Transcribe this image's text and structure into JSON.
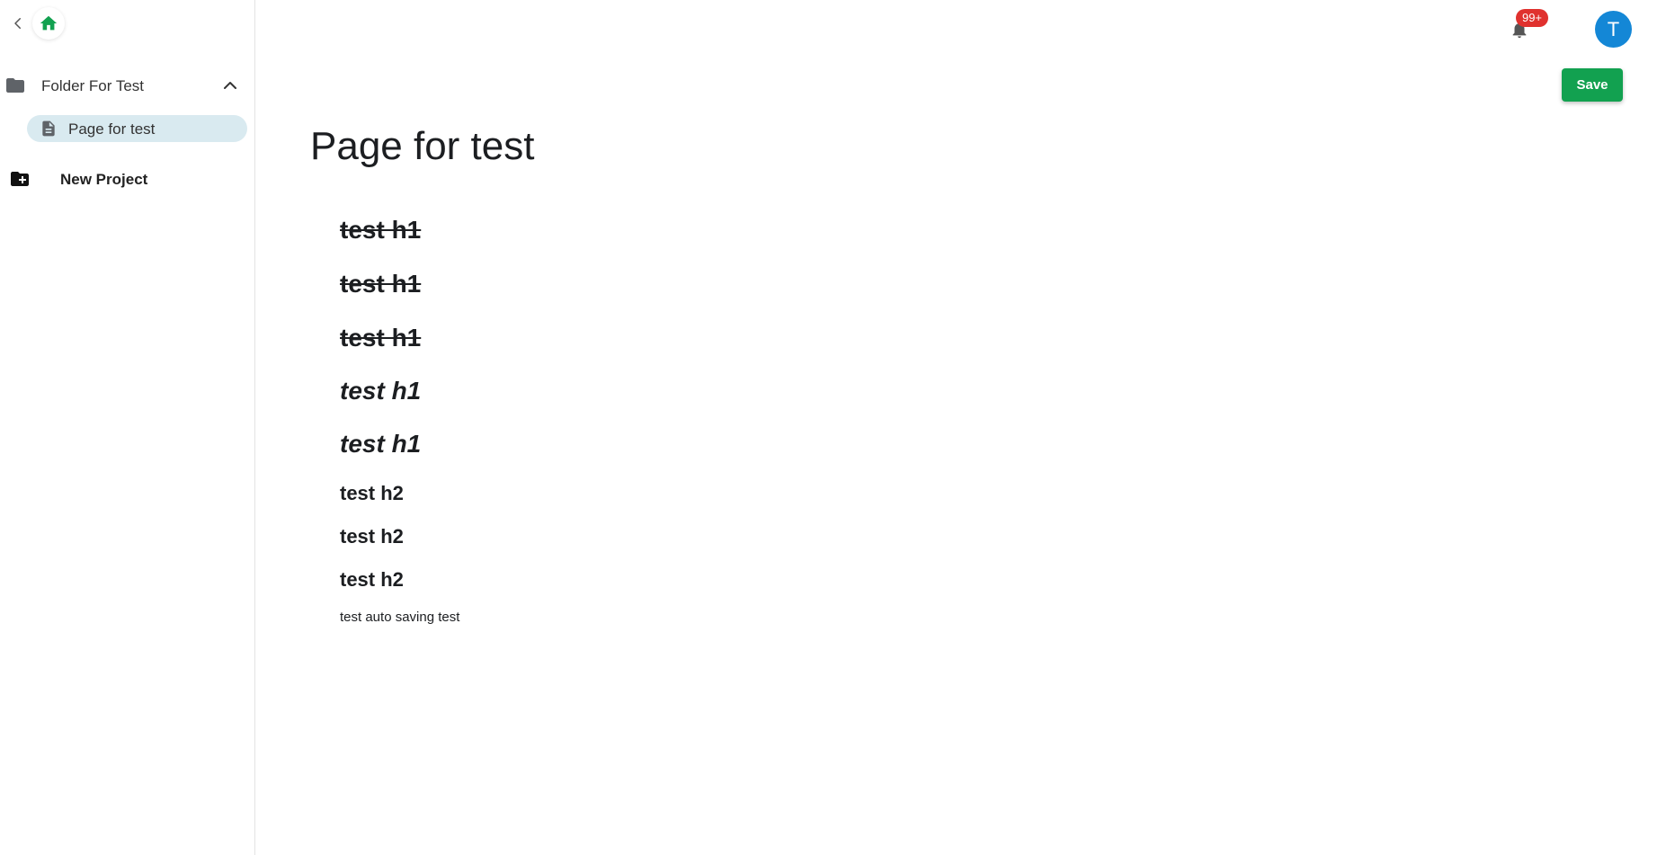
{
  "sidebar": {
    "folder": {
      "label": "Folder For Test",
      "icon": "folder-icon",
      "expanded": true
    },
    "pages": [
      {
        "label": "Page for test",
        "icon": "document-icon",
        "active": true
      }
    ],
    "new_project": {
      "label": "New Project",
      "icon": "folder-plus-icon"
    }
  },
  "header": {
    "notifications": {
      "badge": "99+"
    },
    "avatar": {
      "initial": "T",
      "color": "#1487d6"
    },
    "save_label": "Save"
  },
  "editor": {
    "title": "Page for test",
    "blocks": [
      {
        "type": "h1",
        "style": "strikethrough",
        "text": "test h1"
      },
      {
        "type": "h1",
        "style": "strikethrough",
        "text": "test h1"
      },
      {
        "type": "h1",
        "style": "strikethrough",
        "text": "test h1"
      },
      {
        "type": "h1",
        "style": "italic",
        "text": "test h1"
      },
      {
        "type": "h1",
        "style": "italic",
        "text": "test h1"
      },
      {
        "type": "h2",
        "style": "bold",
        "text": "test h2"
      },
      {
        "type": "h2",
        "style": "bold",
        "text": "test h2"
      },
      {
        "type": "h2",
        "style": "bold",
        "text": "test h2"
      },
      {
        "type": "paragraph",
        "style": "normal",
        "text": "test auto saving test"
      }
    ]
  },
  "colors": {
    "accent_green": "#12a150",
    "active_item_bg": "#d9eaf0",
    "badge_red": "#e0312e",
    "home_icon_green": "#12a150"
  }
}
